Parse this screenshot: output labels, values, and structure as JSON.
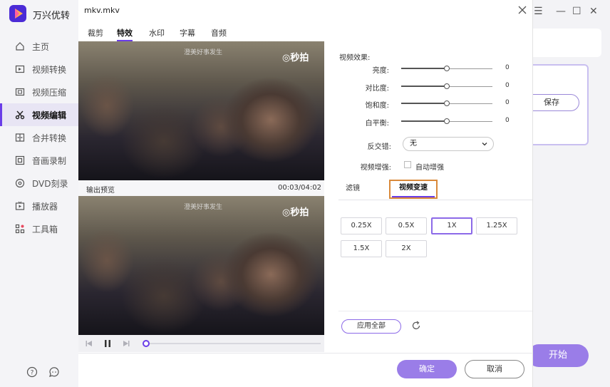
{
  "app": {
    "name": "万兴优转"
  },
  "sidebar": {
    "items": [
      {
        "label": "主页",
        "icon": "home-icon"
      },
      {
        "label": "视频转换",
        "icon": "convert-icon"
      },
      {
        "label": "视频压缩",
        "icon": "compress-icon"
      },
      {
        "label": "视频编辑",
        "icon": "scissors-icon",
        "active": true
      },
      {
        "label": "合并转换",
        "icon": "merge-icon"
      },
      {
        "label": "音画录制",
        "icon": "record-icon"
      },
      {
        "label": "DVD刻录",
        "icon": "disc-icon"
      },
      {
        "label": "播放器",
        "icon": "player-icon"
      },
      {
        "label": "工具箱",
        "icon": "toolbox-icon"
      }
    ],
    "bottom_icons": [
      "help-icon",
      "feedback-icon"
    ]
  },
  "background_window": {
    "controls": [
      "☰",
      "—",
      "☐",
      "✕"
    ],
    "save_label": "保存",
    "start_label": "开始"
  },
  "dialog": {
    "title": "mkv.mkv",
    "tabs": [
      {
        "label": "裁剪"
      },
      {
        "label": "特效",
        "active": true
      },
      {
        "label": "水印"
      },
      {
        "label": "字幕"
      },
      {
        "label": "音频"
      }
    ],
    "video_watermark": "澄美好事发生",
    "video_logo": "◎秒拍",
    "preview_label": "输出预览",
    "preview_time": "00:03/04:02",
    "playback_position": 0.0,
    "effects": {
      "title": "视频效果:",
      "sliders": [
        {
          "label": "亮度:",
          "value": "0",
          "position": 0.5
        },
        {
          "label": "对比度:",
          "value": "0",
          "position": 0.5
        },
        {
          "label": "饱和度:",
          "value": "0",
          "position": 0.5
        },
        {
          "label": "白平衡:",
          "value": "0",
          "position": 0.5
        }
      ],
      "deinterlace_label": "反交错:",
      "deinterlace_value": "无",
      "enhance_label": "视频增强:",
      "enhance_option": "自动增强",
      "enhance_checked": false
    },
    "subtabs": [
      {
        "label": "滤镜"
      },
      {
        "label": "视频变速",
        "active": true
      }
    ],
    "speeds": [
      {
        "label": "0.25X"
      },
      {
        "label": "0.5X"
      },
      {
        "label": "1X",
        "selected": true
      },
      {
        "label": "1.25X"
      },
      {
        "label": "1.5X"
      },
      {
        "label": "2X"
      }
    ],
    "apply_all_label": "应用全部",
    "ok_label": "确定",
    "cancel_label": "取消"
  },
  "colors": {
    "accent": "#6a3de8",
    "accent_light": "#9a7de8",
    "highlight_border": "#d9893a"
  }
}
